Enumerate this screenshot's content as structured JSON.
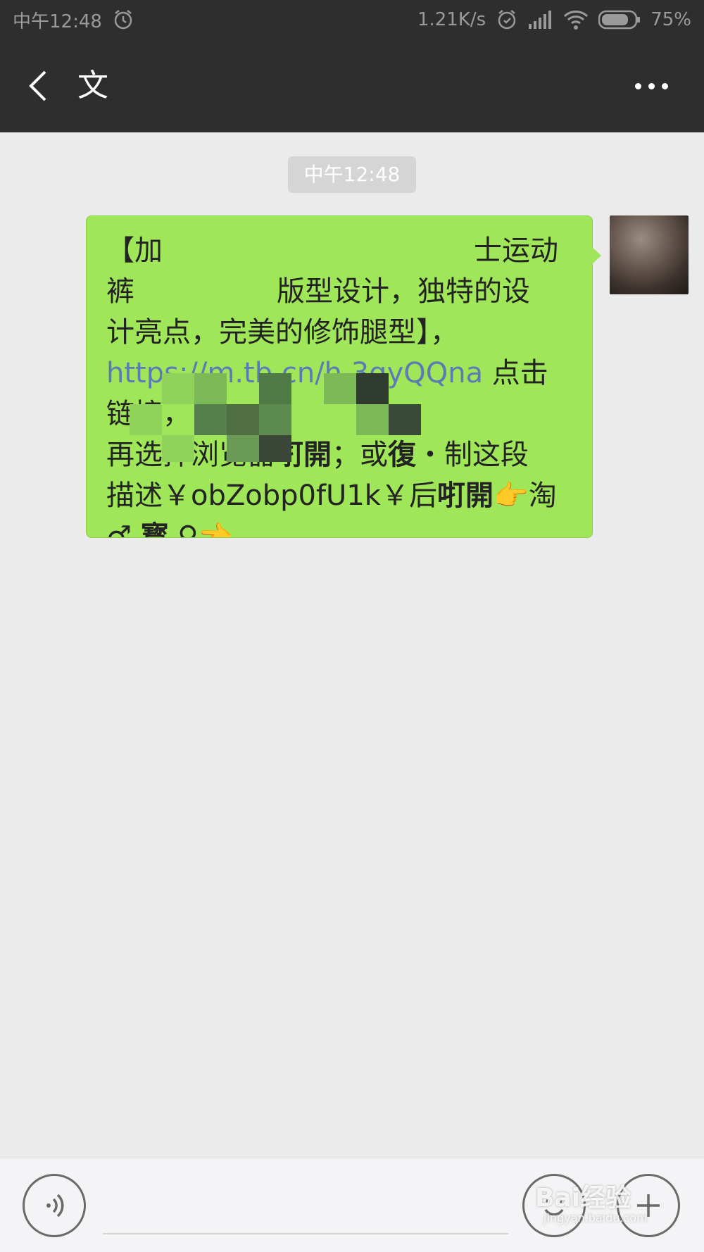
{
  "status_bar": {
    "time": "中午12:48",
    "network_speed": "1.21K/s",
    "battery": "75%",
    "icons": [
      "alarm-icon",
      "alarm-icon",
      "signal-icon",
      "wifi-icon",
      "battery-icon"
    ]
  },
  "nav": {
    "title": "文",
    "back_icon": "chevron-left-icon",
    "more_icon": "more-dots-icon"
  },
  "chat": {
    "timestamp": "中午12:48",
    "message": {
      "line1_start": "【加",
      "line1_end": "士运动",
      "line2_start": "裤",
      "line2_mid": "版型设计，",
      "line2_end": "独特的设",
      "line3": "计亮点，完美的修饰腿型】，",
      "link": "https://m.tb.cn/h.3qyQQna",
      "after_link": " 点击链接，",
      "line5_a": "再选择浏览器",
      "line5_b": "咑開",
      "line5_c": "；或",
      "line5_d": "復",
      "line5_e": "・制这段",
      "line6_a": "描述￥obZobp0fU1k￥后",
      "line6_b": "咑開",
      "line6_emoji": "👉",
      "line6_c": "淘",
      "line7_a": "♂",
      "line7_b": "寳",
      "line7_c": "♀",
      "line7_emoji": "👈"
    }
  },
  "input_bar": {
    "voice_icon": "voice-icon",
    "emoji_icon": "emoji-icon",
    "plus_icon": "plus-icon",
    "input_value": ""
  },
  "watermark": {
    "text": "Bai经验",
    "sub": "jingyan.baidu.com"
  },
  "colors": {
    "bar_bg": "#2e2e2e",
    "chat_bg": "#ebebeb",
    "bubble_bg": "#9fe659",
    "link": "#5b7bb4"
  }
}
